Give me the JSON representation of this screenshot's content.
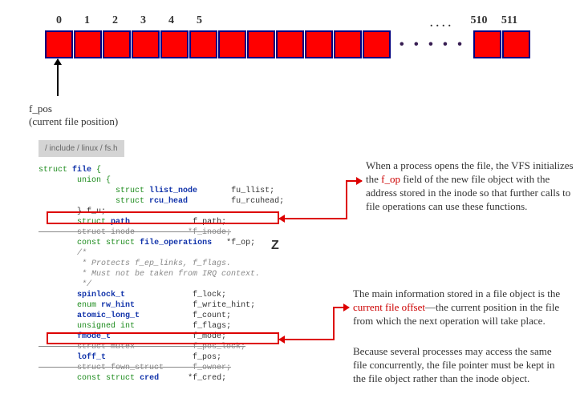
{
  "byte_array": {
    "head_indices": [
      "0",
      "1",
      "2",
      "3",
      "4",
      "5"
    ],
    "ellipsis": "....",
    "tail_indices": [
      "510",
      "511"
    ],
    "head_cell_count": 12,
    "dot_glyphs": "• • • • •",
    "tail_cell_count": 2
  },
  "fpos_pointer": {
    "label_line1": "f_pos",
    "label_line2": "(current file position)"
  },
  "code": {
    "header": "/ include / linux / fs.h",
    "lines": [
      {
        "raw": "struct file {",
        "cls": "kw"
      },
      {
        "raw": "        union {",
        "cls": "kw"
      },
      {
        "raw": "                struct llist_node       fu_llist;",
        "cls": ""
      },
      {
        "raw": "                struct rcu_head         fu_rcuhead;",
        "cls": ""
      },
      {
        "raw": "        } f_u;",
        "cls": ""
      },
      {
        "raw": "        struct path             f_path;",
        "cls": ""
      },
      {
        "raw": "        struct inode           *f_inode;",
        "cls": "strike"
      },
      {
        "raw": "        const struct file_operations   *f_op;",
        "cls": ""
      },
      {
        "raw": "",
        "cls": ""
      },
      {
        "raw": "        /*",
        "cls": "cmt"
      },
      {
        "raw": "         * Protects f_ep_links, f_flags.",
        "cls": "cmt"
      },
      {
        "raw": "         * Must not be taken from IRQ context.",
        "cls": "cmt"
      },
      {
        "raw": "         */",
        "cls": "cmt"
      },
      {
        "raw": "        spinlock_t              f_lock;",
        "cls": ""
      },
      {
        "raw": "        enum rw_hint            f_write_hint;",
        "cls": ""
      },
      {
        "raw": "        atomic_long_t           f_count;",
        "cls": ""
      },
      {
        "raw": "        unsigned int            f_flags;",
        "cls": ""
      },
      {
        "raw": "        fmode_t                 f_mode;",
        "cls": ""
      },
      {
        "raw": "        struct mutex            f_pos_lock;",
        "cls": "strike"
      },
      {
        "raw": "        loff_t                  f_pos;",
        "cls": ""
      },
      {
        "raw": "        struct fown_struct      f_owner;",
        "cls": "strike"
      },
      {
        "raw": "        const struct cred      *f_cred;",
        "cls": ""
      }
    ]
  },
  "annotations": {
    "para1_pre": "When a process opens the file, the VFS initializes the ",
    "para1_term": "f_op",
    "para1_post": " field of the new file object with the address stored in the inode so that further calls to file operations can use these functions.",
    "para2_pre": "The main information stored in a file object is the ",
    "para2_term": "current file offset",
    "para2_post": "—the current position in the file from which the next operation will take place.",
    "para3": "Because several processes may access the same file concurrently, the file pointer must be kept in the file object rather than the inode object."
  },
  "stray": {
    "z": "Z"
  }
}
